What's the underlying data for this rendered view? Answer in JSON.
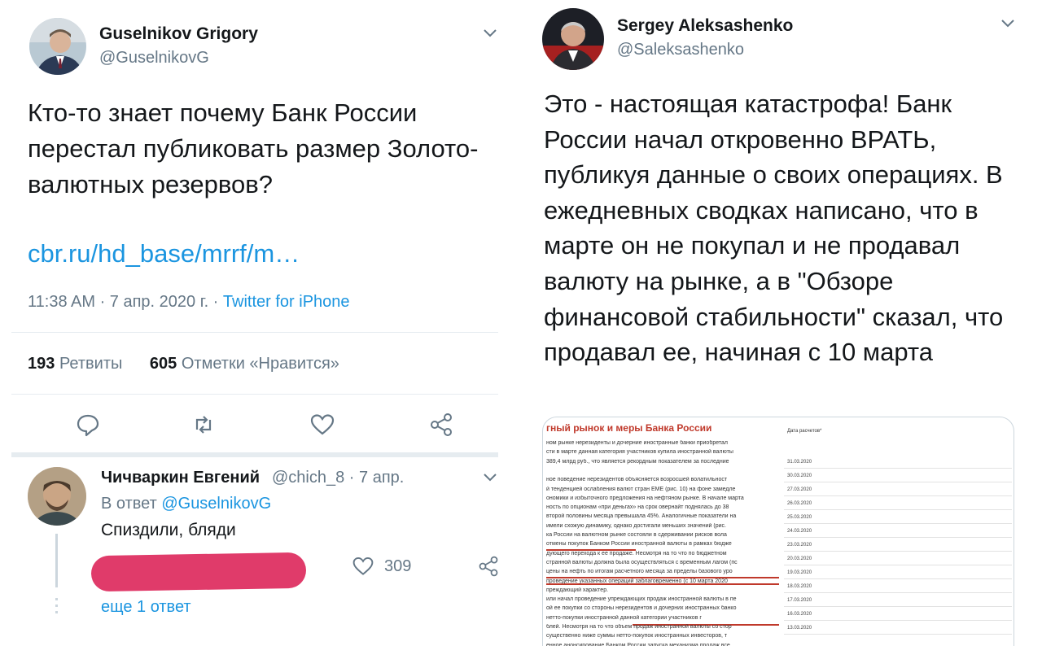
{
  "left_tweet": {
    "author_name": "Guselnikov Grigory",
    "author_handle": "@GuselnikovG",
    "text": "Кто-то знает почему Банк России перестал публиковать размер Золото-валютных резервов?",
    "link": "cbr.ru/hd_base/mrrf/m…",
    "time": "11:38 AM · 7 апр. 2020 г. · ",
    "source": "Twitter for iPhone",
    "retweets_count": "193",
    "retweets_label": "Ретвиты",
    "likes_count": "605",
    "likes_label": "Отметки «Нравится»"
  },
  "reply": {
    "author_name": "Чичваркин Евгений",
    "author_handle": "@chich_8 · 7 апр.",
    "reply_prefix": "В ответ ",
    "reply_to": "@GuselnikovG",
    "text": "Спиздили, бляди",
    "likes_count": "309",
    "more_replies": "еще 1 ответ"
  },
  "right_tweet": {
    "author_name": "Sergey Aleksashenko",
    "author_handle": "@Saleksashenko",
    "text": "Это - настоящая катастрофа! Банк России начал откровенно ВРАТЬ, публикуя данные о своих операциях. В ежедневных сводках написано, что в марте он не покупал и не продавал валюту на рынке, а в \"Обзоре финансовой стабильности\" сказал, что продавал ее, начиная с 10 марта"
  },
  "document_image": {
    "title": "гный рынок и меры Банка России",
    "column_header": "Дата расчетов*",
    "lines": [
      "ном рынке нерезиденты и дочерние иностранные банки приобретал",
      "сти в марте данная категория участников купила иностранной валюты",
      "389,4 млрд руб., что является рекордным показателем за последние",
      "",
      "ное поведение нерезидентов объясняется возросшей волатильност",
      "й тенденцией ослабления валют стран ЕМЕ (рис. 10) на фоне замедле",
      "ономики и избыточного предложения на нефтяном рынке. В начале марта",
      "ность по опционам «при деньгах» на срок овернайт поднялась до 38",
      "второй половины месяца превышала 45%. Аналогичные показатели на",
      "имели схожую динамику, однако достигали меньших значений (рис.",
      "ка России на валютном рынке состояли в сдерживании рисков вола",
      "отмены покупок Банком России иностранной валюты в рамках бюдже",
      "дующего перехода к ее продаже. Несмотря на то что по бюджетном",
      "странной валюты должна была осуществляться с временным лагом (пс",
      "цены на нефть по итогам расчетного месяца за пределы базового уро",
      "проведение указанных операций заблаговременно (с 10 марта 2020",
      "преждающий характер.",
      "или начал проведение упреждающих продаж иностранной валюты в пе",
      "ой ее покупки со стороны нерезидентов и дочерних иностранных банко",
      "нетто-покупки иностранной данной категории участников г",
      "блей. Несмотря на то что объем продаж иностранной валюты со стор",
      "существенно ниже суммы нетто-покупок иностранных инвесторов, т",
      "енное анонсирование Банком России запуска механизма продаж все"
    ],
    "dates": [
      "31.03.2020",
      "30.03.2020",
      "27.03.2020",
      "26.03.2020",
      "25.03.2020",
      "24.03.2020",
      "23.03.2020",
      "20.03.2020",
      "19.03.2020",
      "18.03.2020",
      "17.03.2020",
      "16.03.2020",
      "13.03.2020"
    ]
  },
  "colors": {
    "link_blue": "#1b95e0",
    "secondary_gray": "#657786",
    "redaction_pink": "#e03b6a"
  }
}
